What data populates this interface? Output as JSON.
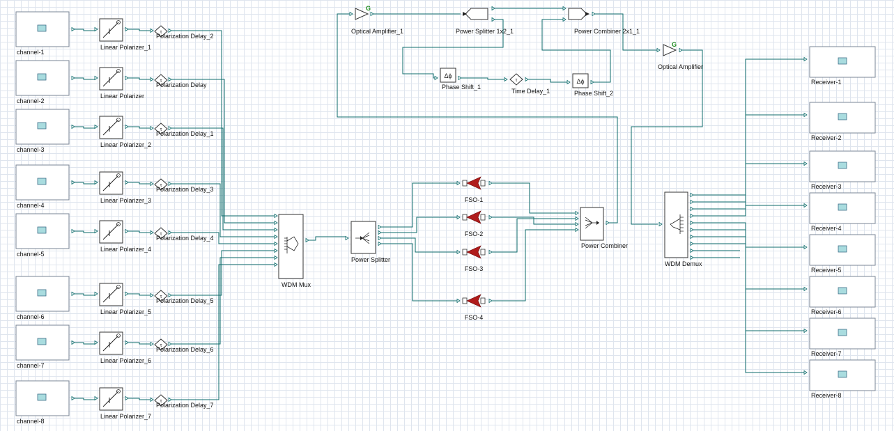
{
  "channels": [
    "channel-1",
    "channel-2",
    "channel-3",
    "channel-4",
    "channel-5",
    "channel-6",
    "channel-7",
    "channel-8"
  ],
  "polarizers": [
    "Linear Polarizer_1",
    "Linear Polarizer",
    "Linear Polarizer_2",
    "Linear Polarizer_3",
    "Linear Polarizer_4",
    "Linear Polarizer_5",
    "Linear Polarizer_6",
    "Linear Polarizer_7"
  ],
  "delays": [
    "Polarization Delay_2",
    "Polarization Delay",
    "Polarization Delay_1",
    "Polarization Delay_3",
    "Polarization Delay_4",
    "Polarization Delay_5",
    "Polarization Delay_6",
    "Polarization Delay_7"
  ],
  "wdm_mux": "WDM Mux",
  "power_splitter": "Power Splitter",
  "fso": [
    "FSO-1",
    "FSO-2",
    "FSO-3",
    "FSO-4"
  ],
  "power_combiner": "Power Combiner",
  "wdm_demux": "WDM Demux",
  "receivers": [
    "Receiver-1",
    "Receiver-2",
    "Receiver-3",
    "Receiver-4",
    "Receiver-5",
    "Receiver-6",
    "Receiver-7",
    "Receiver-8"
  ],
  "optical_amplifier_1": "Optical Amplifier_1",
  "power_splitter_1x2": "Power Splitter 1x2_1",
  "power_combiner_2x1": "Power Combiner 2x1_1",
  "optical_amplifier": "Optical Amplifier",
  "phase_shift_1": "Phase Shift_1",
  "time_delay_1": "Time Delay_1",
  "phase_shift_2": "Phase Shift_2",
  "gain_symbol": "G"
}
